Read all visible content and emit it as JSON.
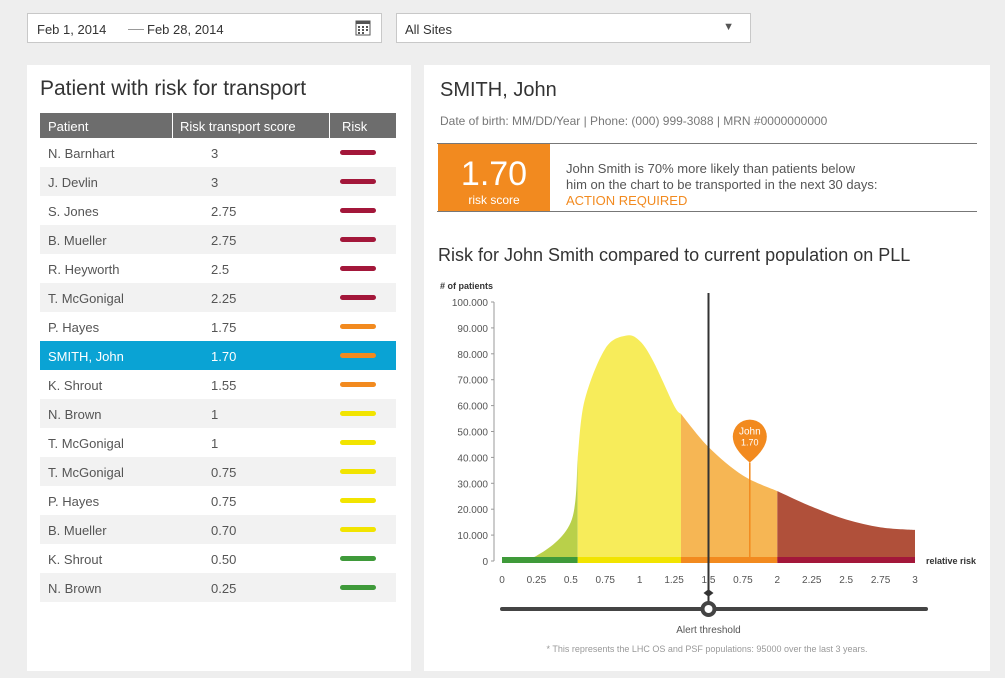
{
  "filters": {
    "date_start": "Feb 1, 2014",
    "date_end": "Feb 28, 2014",
    "site": "All Sites"
  },
  "left": {
    "title": "Patient with risk for transport",
    "columns": [
      "Patient",
      "Risk transport score",
      "Risk"
    ],
    "rows": [
      {
        "name": "N. Barnhart",
        "score": "3",
        "risk": "high"
      },
      {
        "name": "J. Devlin",
        "score": "3",
        "risk": "high"
      },
      {
        "name": "S. Jones",
        "score": "2.75",
        "risk": "high"
      },
      {
        "name": "B. Mueller",
        "score": "2.75",
        "risk": "high"
      },
      {
        "name": "R. Heyworth",
        "score": "2.5",
        "risk": "high"
      },
      {
        "name": "T. McGonigal",
        "score": "2.25",
        "risk": "high"
      },
      {
        "name": "P. Hayes",
        "score": "1.75",
        "risk": "medium"
      },
      {
        "name": "SMITH, John",
        "score": "1.70",
        "risk": "medium",
        "selected": true
      },
      {
        "name": "K. Shrout",
        "score": "1.55",
        "risk": "medium"
      },
      {
        "name": "N. Brown",
        "score": "1",
        "risk": "low"
      },
      {
        "name": "T. McGonigal",
        "score": "1",
        "risk": "low"
      },
      {
        "name": "T. McGonigal",
        "score": "0.75",
        "risk": "low"
      },
      {
        "name": "P. Hayes",
        "score": "0.75",
        "risk": "low"
      },
      {
        "name": "B. Mueller",
        "score": "0.70",
        "risk": "low"
      },
      {
        "name": "K. Shrout",
        "score": "0.50",
        "risk": "minimal"
      },
      {
        "name": "N. Brown",
        "score": "0.25",
        "risk": "minimal"
      }
    ]
  },
  "risk_colors": {
    "high": "#a3173a",
    "medium": "#f28a1f",
    "low": "#f2e400",
    "minimal": "#3f9a3a"
  },
  "patient": {
    "name": "SMITH, John",
    "info": "Date of birth: MM/DD/Year  |  Phone: (000) 999-3088  |  MRN #0000000000",
    "score": "1.70",
    "score_label": "risk score",
    "text_line1": "John Smith is 70% more likely than patients below",
    "text_line2": "him on the chart to be transported in the next 30 days:",
    "action": "ACTION REQUIRED"
  },
  "chart_data": {
    "type": "area",
    "title": "Risk for John Smith compared to current population on PLL",
    "ylabel": "# of patients",
    "xlabel": "relative risk",
    "y_ticks": [
      "100.000",
      "90.000",
      "80.000",
      "70.000",
      "60.000",
      "50.000",
      "40.000",
      "30.000",
      "20.000",
      "10.000",
      "0"
    ],
    "x_ticks": [
      "0",
      "0.25",
      "0.5",
      "0.75",
      "1",
      "1.25",
      "1.5",
      "0.75",
      "2",
      "2.25",
      "2.5",
      "2.75",
      "3"
    ],
    "curve": {
      "x": [
        0,
        0.25,
        0.5,
        0.55,
        0.6,
        0.75,
        0.9,
        1.0,
        1.1,
        1.25,
        1.5,
        1.75,
        2.0,
        2.25,
        2.5,
        2.75,
        3.0
      ],
      "y": [
        0,
        2000,
        15000,
        40000,
        62000,
        82000,
        87000,
        85000,
        77000,
        60000,
        44000,
        33000,
        27000,
        21000,
        16000,
        13000,
        12000
      ]
    },
    "bands": [
      {
        "from": 0,
        "to": 0.55,
        "color": "#b9d04a",
        "base": "#3f9a3a"
      },
      {
        "from": 0.55,
        "to": 1.3,
        "color": "#f7ec5a",
        "base": "#f2e400"
      },
      {
        "from": 1.3,
        "to": 2.0,
        "color": "#f6b654",
        "base": "#f28a1f"
      },
      {
        "from": 2.0,
        "to": 3.0,
        "color": "#b0503a",
        "base": "#a3173a"
      }
    ],
    "patient_marker": {
      "label": "John",
      "value": "1.70",
      "x": 1.8,
      "y": 38000
    },
    "threshold": {
      "x": 1.5,
      "label": "Alert threshold"
    },
    "footnote": "* This represents the LHC OS and PSF populations: 95000 over the last 3 years."
  }
}
